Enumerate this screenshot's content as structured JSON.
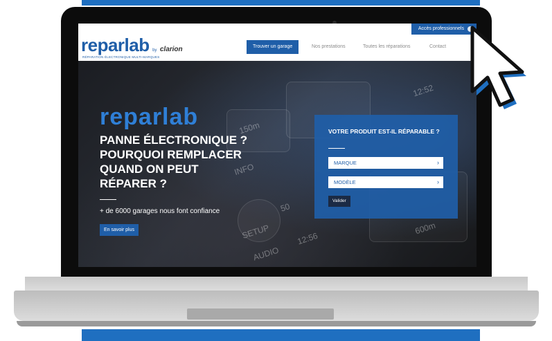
{
  "colors": {
    "accent": "#1f5ea8",
    "hero_brand": "#2f7fd6",
    "frame_accent": "#1f6fc0",
    "form_button": "#1b2a44"
  },
  "header": {
    "pro_link": "Accès professionnels",
    "logo": {
      "name": "reparlab",
      "by": "by",
      "partner": "clarion",
      "tagline": "RÉPARATION ÉLECTRONIQUE MULTI-MARQUES"
    },
    "nav": {
      "cta": "Trouver un garage",
      "items": [
        "Nos prestations",
        "Toutes les réparations",
        "Contact"
      ]
    }
  },
  "hero": {
    "brand": "reparlab",
    "title_lines": [
      "PANNE ÉLECTRONIQUE ?",
      "POURQUOI REMPLACER",
      "QUAND ON PEUT",
      "RÉPARER ?"
    ],
    "subtitle": "+ de 6000 garages nous font confiance",
    "button": "En savoir plus",
    "background_texts": [
      "INFO",
      "SETUP",
      "AUDIO",
      "12:56",
      "12:52",
      "600m",
      "150m",
      "50"
    ]
  },
  "form": {
    "title": "VOTRE PRODUIT EST-IL RÉPARABLE ?",
    "brand_select": "MARQUE",
    "model_select": "MODÈLE",
    "submit": "Valider"
  },
  "icons": {
    "cursor": "arrow-cursor-icon",
    "chevron": "chevron-right-icon",
    "user": "user-icon"
  }
}
